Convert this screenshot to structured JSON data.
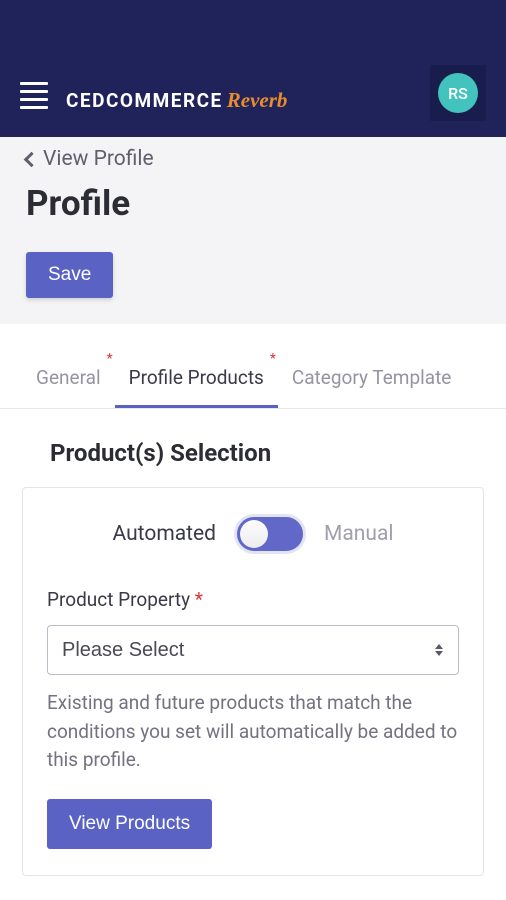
{
  "header": {
    "logo_main": "CEDCOMMERCE",
    "logo_sub": "Reverb",
    "avatar_initials": "RS"
  },
  "breadcrumb": {
    "back_label": "View Profile"
  },
  "page": {
    "title": "Profile",
    "save_label": "Save"
  },
  "tabs": {
    "general": "General",
    "profile_products": "Profile Products",
    "category_template": "Category Template"
  },
  "section": {
    "title": "Product(s) Selection"
  },
  "toggle": {
    "automated": "Automated",
    "manual": "Manual"
  },
  "form": {
    "property_label": "Product Property",
    "select_placeholder": "Please Select",
    "help_text": "Existing and future products that match the conditions you set will automatically be added to this profile.",
    "view_products": "View Products"
  }
}
